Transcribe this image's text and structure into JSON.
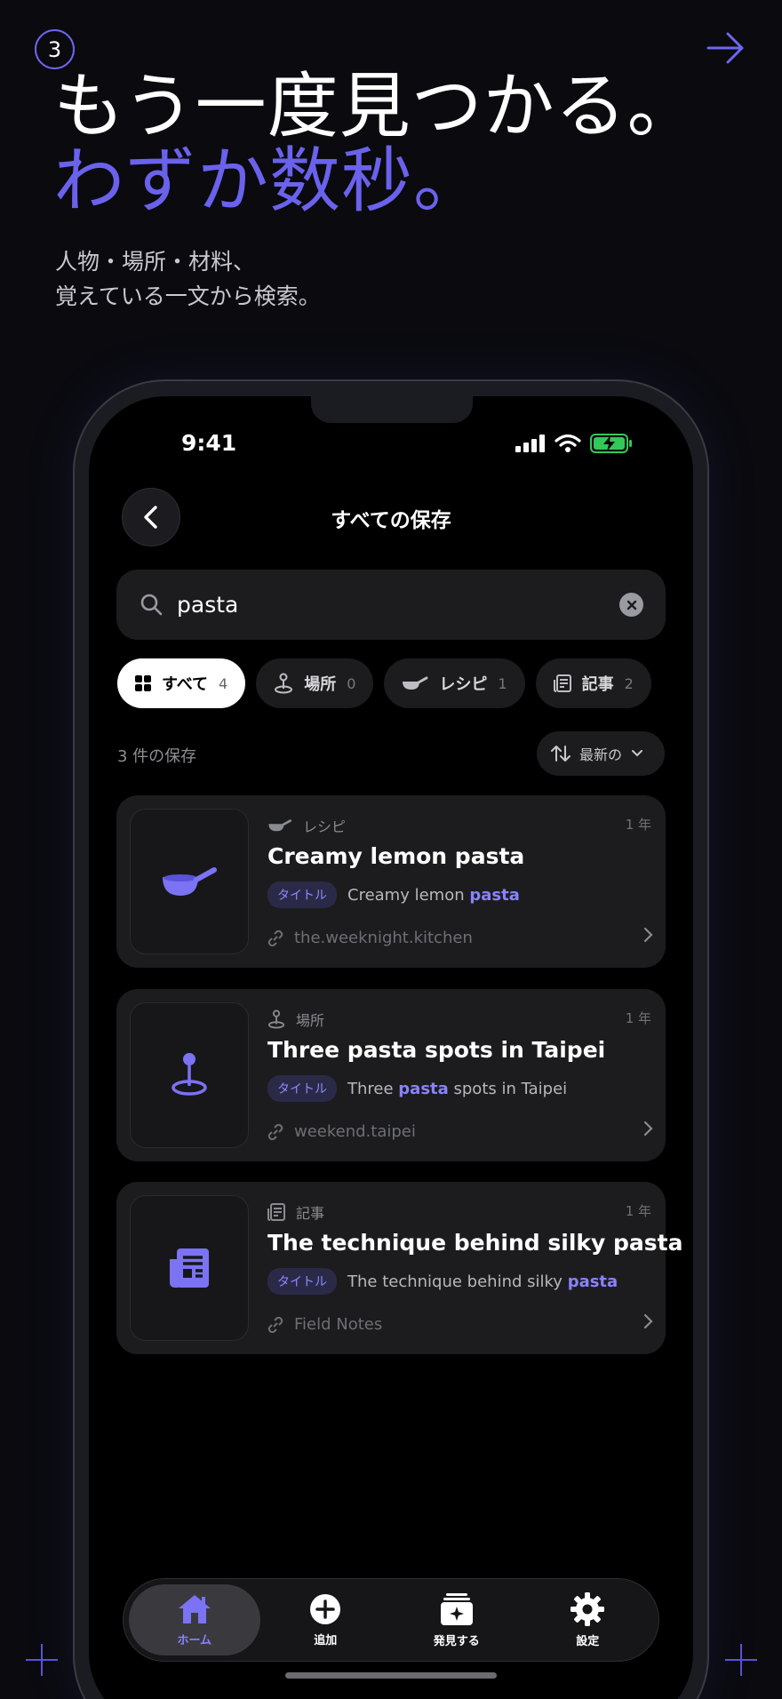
{
  "promo": {
    "step": "3",
    "headline_line1": "もう一度見つかる。",
    "headline_line2": "わずか数秒。",
    "sub_line1": "人物・場所・材料、",
    "sub_line2": "覚えている一文から検索。"
  },
  "status": {
    "time": "9:41"
  },
  "nav": {
    "title": "すべての保存"
  },
  "search": {
    "value": "pasta"
  },
  "filters": [
    {
      "label": "すべて",
      "count": "4",
      "icon": "grid-icon",
      "active": true
    },
    {
      "label": "場所",
      "count": "0",
      "icon": "pin-icon",
      "active": false
    },
    {
      "label": "レシピ",
      "count": "1",
      "icon": "pan-icon",
      "active": false
    },
    {
      "label": "記事",
      "count": "2",
      "icon": "article-icon",
      "active": false
    }
  ],
  "results": {
    "count_label": "3 件の保存",
    "sort_label": "最新の"
  },
  "cards": [
    {
      "category": "レシピ",
      "age": "1 年",
      "title": "Creamy lemon pasta",
      "tag": "タイトル",
      "match_before": "Creamy lemon ",
      "match_hl": "pasta",
      "match_after": "",
      "source": "the.weeknight.kitchen",
      "icon": "pan-icon"
    },
    {
      "category": "場所",
      "age": "1 年",
      "title": "Three pasta spots in Taipei",
      "tag": "タイトル",
      "match_before": "Three ",
      "match_hl": "pasta",
      "match_after": " spots in Taipei",
      "source": "weekend.taipei",
      "icon": "pin-icon"
    },
    {
      "category": "記事",
      "age": "1 年",
      "title": "The technique behind silky pasta",
      "tag": "タイトル",
      "match_before": "The technique behind silky ",
      "match_hl": "pasta",
      "match_after": "",
      "source": "Field Notes",
      "icon": "article-icon"
    }
  ],
  "tabs": [
    {
      "label": "ホーム",
      "icon": "home-icon",
      "active": true
    },
    {
      "label": "追加",
      "icon": "plus-circle-icon",
      "active": false
    },
    {
      "label": "発見する",
      "icon": "discover-icon",
      "active": false
    },
    {
      "label": "設定",
      "icon": "gear-icon",
      "active": false
    }
  ],
  "colors": {
    "accent": "#6a62ec",
    "background": "#0a0a0f",
    "card": "#1c1c1e",
    "battery": "#34c759"
  }
}
